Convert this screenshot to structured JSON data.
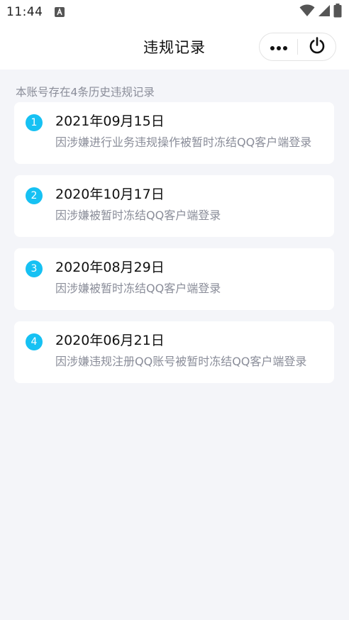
{
  "status_bar": {
    "time": "11:44",
    "notification_icon": "app-notification-icon",
    "icons": [
      "wifi-icon",
      "signal-icon",
      "battery-icon"
    ]
  },
  "nav": {
    "title": "违规记录",
    "more_icon": "more-dots-icon",
    "power_icon": "power-icon"
  },
  "summary": "本账号存在4条历史违规记录",
  "records": [
    {
      "index": "1",
      "date": "2021年09月15日",
      "desc": "因涉嫌进行业务违规操作被暂时冻结QQ客户端登录"
    },
    {
      "index": "2",
      "date": "2020年10月17日",
      "desc": "因涉嫌被暂时冻结QQ客户端登录"
    },
    {
      "index": "3",
      "date": "2020年08月29日",
      "desc": "因涉嫌被暂时冻结QQ客户端登录"
    },
    {
      "index": "4",
      "date": "2020年06月21日",
      "desc": "因涉嫌违规注册QQ账号被暂时冻结QQ客户端登录"
    }
  ],
  "colors": {
    "accent": "#16c1f3",
    "background": "#f4f5f9",
    "muted_text": "#8a8d99"
  }
}
